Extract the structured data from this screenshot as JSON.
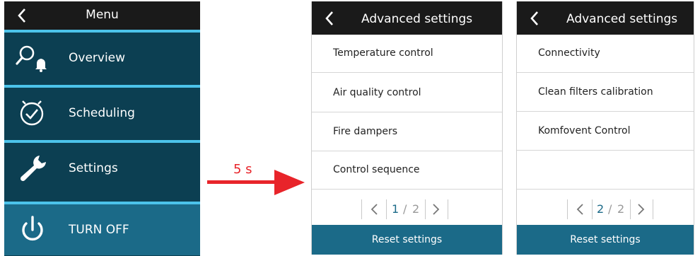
{
  "menu": {
    "title": "Menu",
    "items": [
      {
        "label": "Overview"
      },
      {
        "label": "Scheduling"
      },
      {
        "label": "Settings"
      },
      {
        "label": "TURN OFF"
      }
    ]
  },
  "transition": {
    "label": "5 s"
  },
  "panels": [
    {
      "title": "Advanced settings",
      "items": [
        "Temperature control",
        "Air quality control",
        "Fire dampers",
        "Control sequence"
      ],
      "page": {
        "current": "1",
        "separator": "/",
        "total": "2"
      },
      "reset_label": "Reset settings"
    },
    {
      "title": "Advanced settings",
      "items": [
        "Connectivity",
        "Clean filters calibration",
        "Komfovent Control"
      ],
      "page": {
        "current": "2",
        "separator": "/",
        "total": "2"
      },
      "reset_label": "Reset settings"
    }
  ],
  "colors": {
    "menu_bg": "#0c3f52",
    "separator": "#4cc3ea",
    "turnoff_bg": "#1b6a88",
    "header_bg": "#1a1a1a",
    "accent": "#1b6a88",
    "arrow": "#e8242a"
  }
}
